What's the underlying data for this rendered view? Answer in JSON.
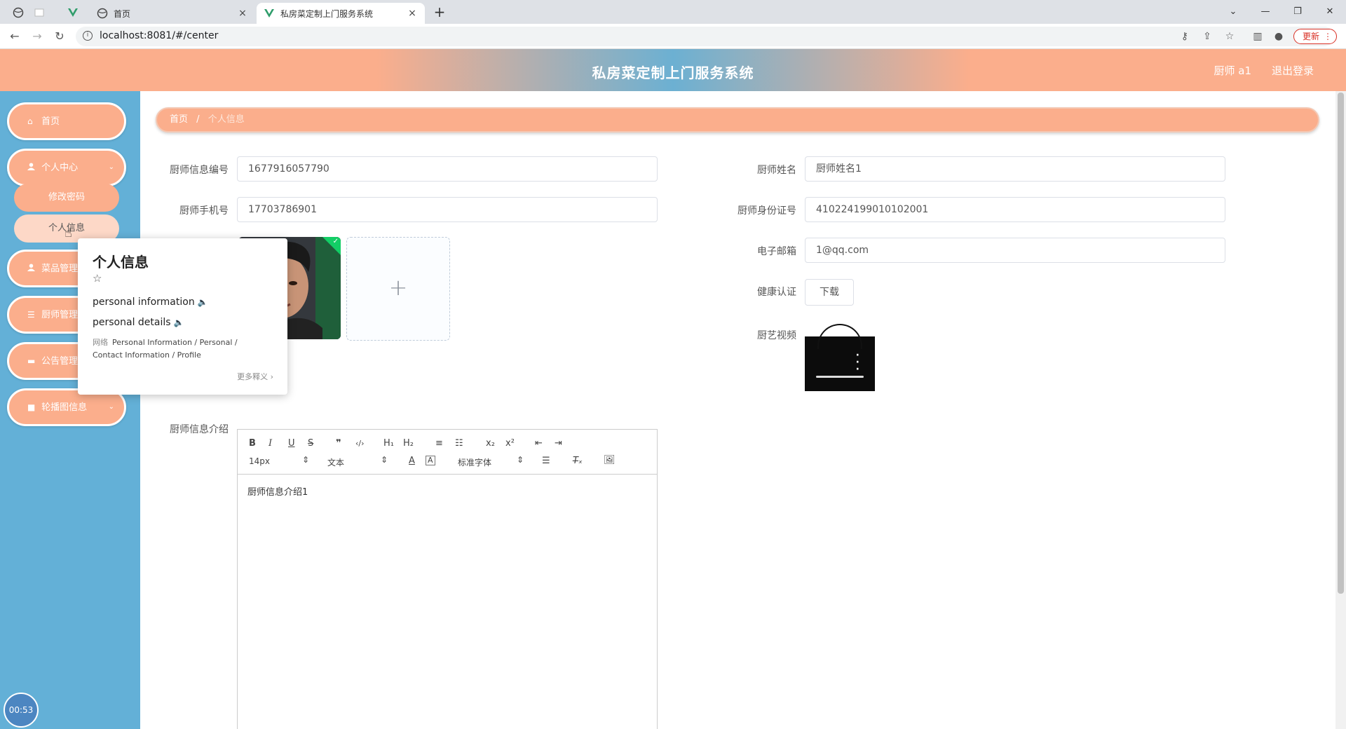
{
  "browser": {
    "tabs": [
      {
        "title": "首页",
        "close": "×"
      },
      {
        "title": "私房菜定制上门服务系统",
        "close": "×"
      }
    ],
    "new_tab": "+",
    "url": "localhost:8081/#/center",
    "update_label": "更新",
    "window_controls": {
      "collapse": "⌄",
      "minimize": "—",
      "restore": "❐",
      "close": "✕"
    }
  },
  "header": {
    "title": "私房菜定制上门服务系统",
    "user": "厨师 a1",
    "logout": "退出登录"
  },
  "sidebar": {
    "items": [
      {
        "label": "首页",
        "icon": "home-icon",
        "glyph": "⌂"
      },
      {
        "label": "个人中心",
        "icon": "user-icon",
        "glyph": "👤"
      },
      {
        "label": "菜品管理",
        "icon": "user-icon",
        "glyph": "👤"
      },
      {
        "label": "厨师管理",
        "icon": "list-icon",
        "glyph": "☰"
      },
      {
        "label": "公告管理",
        "icon": "monitor-icon",
        "glyph": "▬"
      },
      {
        "label": "轮播图信息",
        "icon": "video-icon",
        "glyph": "■"
      }
    ],
    "visible_labels": {
      "dish": "菜品管理",
      "chef": "厨师管理",
      "notice": "公告管理"
    },
    "submenu": [
      {
        "label": "修改密码"
      },
      {
        "label": "个人信息"
      }
    ],
    "timer": "00:53"
  },
  "breadcrumb": {
    "home": "首页",
    "separator": "/",
    "current": "个人信息"
  },
  "form": {
    "chef_no": {
      "label": "厨师信息编号",
      "value": "1677916057790"
    },
    "chef_name": {
      "label": "厨师姓名",
      "value": "厨师姓名1"
    },
    "phone": {
      "label": "厨师手机号",
      "value": "17703786901"
    },
    "id_card": {
      "label": "厨师身份证号",
      "value": "410224199010102001"
    },
    "email": {
      "label": "电子邮箱",
      "value": "1@qq.com"
    },
    "health": {
      "label": "健康认证",
      "button": "下载"
    },
    "video": {
      "label": "厨艺视频"
    },
    "intro": {
      "label": "厨师信息介绍",
      "content": "厨师信息介绍1"
    }
  },
  "editor": {
    "buttons": [
      "B",
      "I",
      "U",
      "S",
      "❞",
      "‹/›",
      "H₁",
      "H₂",
      "≡",
      "☷",
      "x₂",
      "x²",
      "⇤",
      "⇥"
    ],
    "font_size": "14px",
    "header_select": "文本",
    "font_family": "标准字体"
  },
  "popup": {
    "word": "个人信息",
    "star": "☆",
    "definitions": [
      "personal information",
      "personal details"
    ],
    "source_tag": "网络",
    "source_text": "Personal Information / Personal / Contact Information / Profile",
    "more": "更多释义 ›"
  }
}
